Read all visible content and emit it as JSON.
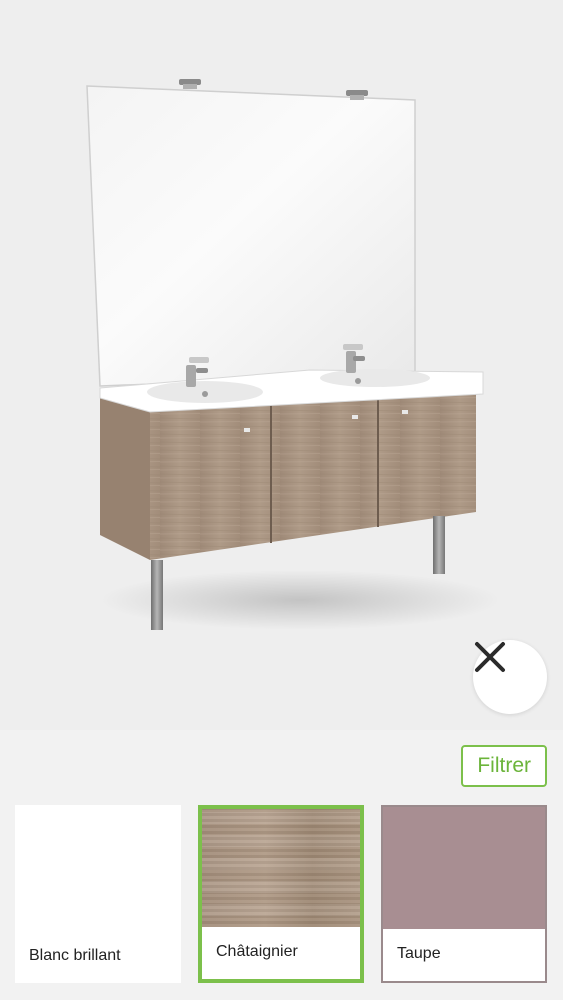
{
  "viewer": {
    "product": "vanity-unit-double-basin",
    "close_icon": "close-icon",
    "colors": {
      "background": "#eeeeee",
      "wood": "#a89584",
      "basin": "#ffffff"
    }
  },
  "panel": {
    "filter_label": "Filtrer",
    "accent_color": "#7cc04b",
    "swatches": [
      {
        "label": "Blanc brillant",
        "color": "#ffffff",
        "selected": false
      },
      {
        "label": "Châtaignier",
        "color": "#a89584",
        "selected": true
      },
      {
        "label": "Taupe",
        "color": "#a88e92",
        "selected": false
      }
    ]
  }
}
